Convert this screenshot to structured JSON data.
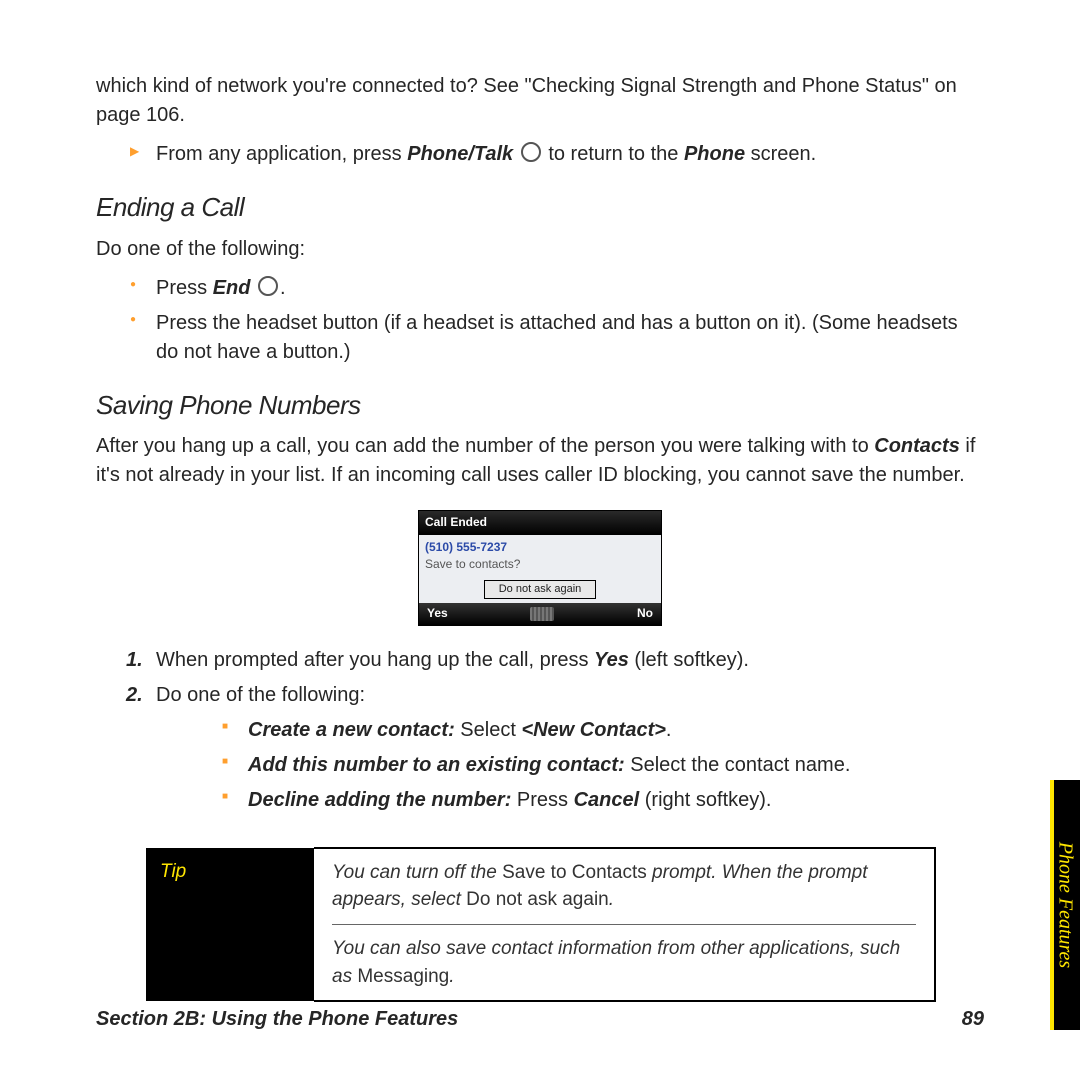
{
  "intro": {
    "cont": "which kind of network you're connected to? See \"Checking Signal Strength and Phone Status\" on page 106.",
    "bullet_pre": "From any application, press ",
    "bullet_key": "Phone/Talk",
    "bullet_mid": " to return to the ",
    "bullet_key2": "Phone",
    "bullet_post": " screen."
  },
  "ending": {
    "heading": "Ending a Call",
    "lead": "Do one of the following:",
    "b1_pre": "Press ",
    "b1_key": "End",
    "b1_post": ".",
    "b2": "Press the headset button (if a headset is attached and has a button on it). (Some headsets do not have a button.)"
  },
  "saving": {
    "heading": "Saving Phone Numbers",
    "lead_pre": "After you hang up a call, you can add the number of the person you were talking with to ",
    "lead_key": "Contacts",
    "lead_post": " if it's not already in your list. If an incoming call uses caller ID blocking, you cannot save the number."
  },
  "dialog": {
    "title": "Call Ended",
    "number": "(510) 555-7237",
    "prompt": "Save to contacts?",
    "checkbox": "Do not ask again",
    "left": "Yes",
    "right": "No"
  },
  "steps": {
    "s1_pre": "When prompted after you hang up the call, press ",
    "s1_key": "Yes",
    "s1_post": " (left softkey).",
    "s2": "Do one of the following:",
    "sub1_key": "Create a new contact:",
    "sub1_mid": " Select ",
    "sub1_val": "<New Contact>",
    "sub1_post": ".",
    "sub2_key": "Add this number to an existing contact:",
    "sub2_post": " Select the contact name.",
    "sub3_key": "Decline adding the number:",
    "sub3_mid": " Press ",
    "sub3_val": "Cancel",
    "sub3_post": " (right softkey)."
  },
  "tip": {
    "label": "Tip",
    "t1_pre": "You can turn off the ",
    "t1_k1": "Save to Contacts",
    "t1_mid": " prompt. When the prompt appears, select ",
    "t1_k2": "Do not ask again",
    "t1_post": ".",
    "t2_pre": "You can also save contact information from other applications, such as ",
    "t2_k1": "Messaging",
    "t2_post": "."
  },
  "footer": {
    "section": "Section 2B: Using the Phone Features",
    "page": "89"
  },
  "sidetab": "Phone Features"
}
